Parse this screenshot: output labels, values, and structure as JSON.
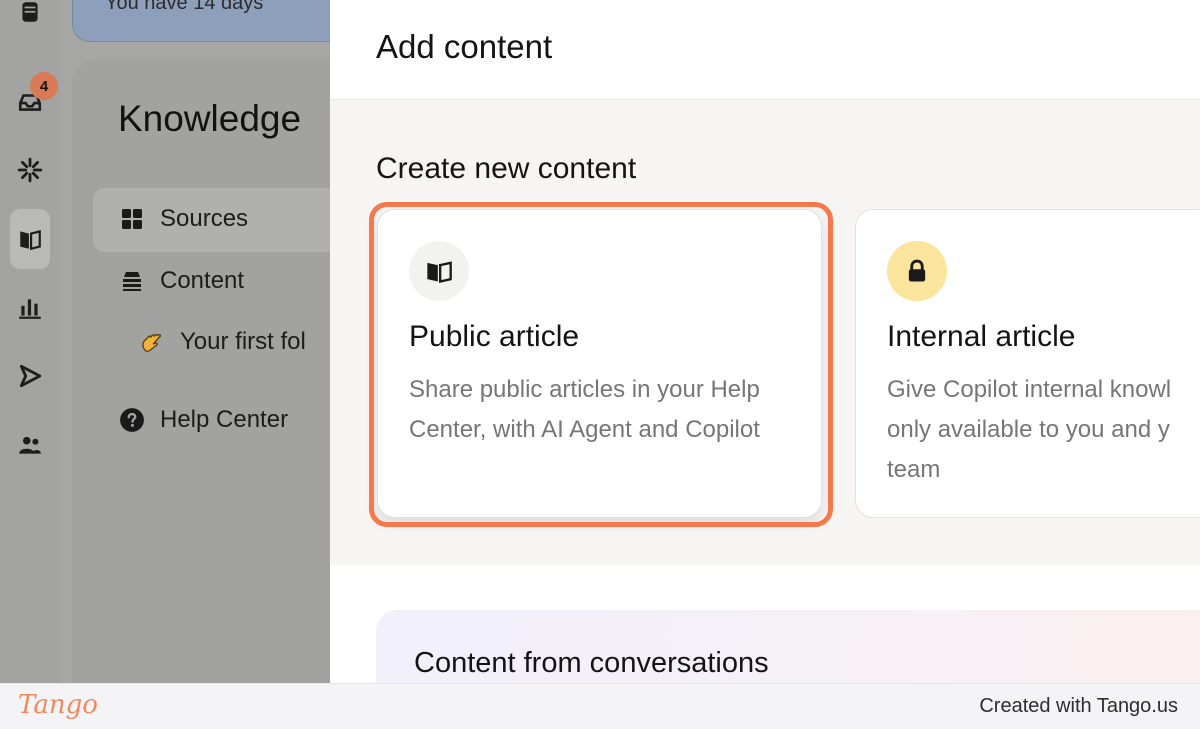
{
  "rail": {
    "inbox_badge": "4",
    "icons": [
      "database-icon",
      "inbox-icon",
      "ai-spark-icon",
      "knowledge-book-icon",
      "reports-chart-icon",
      "outbound-send-icon",
      "contacts-people-icon"
    ]
  },
  "background": {
    "trial_text": "You have 14 days",
    "knowledge_title": "Knowledge",
    "nav": {
      "sources": "Sources",
      "content": "Content",
      "first_folder": "Your first fol",
      "help_center": "Help Center"
    }
  },
  "modal": {
    "title": "Add content",
    "section_title": "Create new content",
    "cards": [
      {
        "icon": "book-icon",
        "title": "Public article",
        "description": "Share public articles in your Help Center, with AI Agent and Copilot",
        "highlighted": true
      },
      {
        "icon": "lock-icon",
        "title": "Internal article",
        "description_lines": [
          "Give Copilot internal knowl",
          "only available to you and y",
          "team"
        ]
      }
    ],
    "conversations_title": "Content from conversations"
  },
  "footer": {
    "logo": "Tango",
    "credit": "Created with Tango.us"
  },
  "colors": {
    "highlight": "#f5794a",
    "lock_icon_bg": "#fbe49b",
    "badge": "#d97a57"
  }
}
